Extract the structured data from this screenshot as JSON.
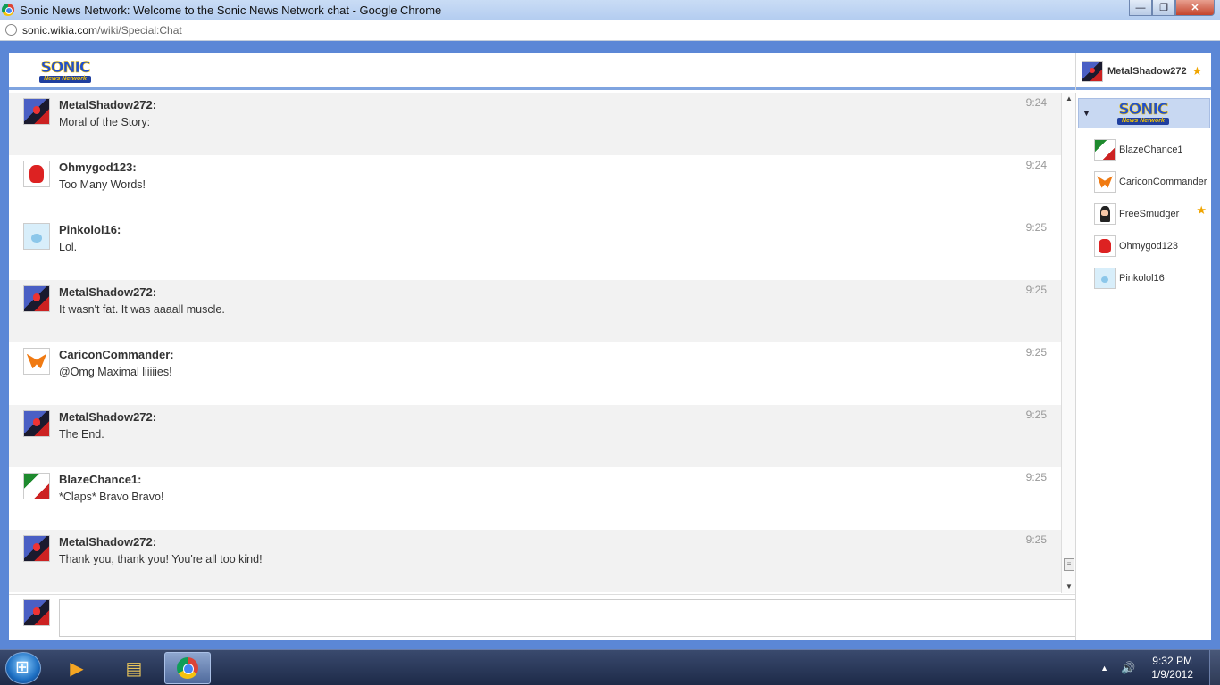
{
  "window": {
    "title": "Sonic News Network: Welcome to the Sonic News Network chat - Google Chrome",
    "minimize": "—",
    "maximize": "❐",
    "close": "✕"
  },
  "address": {
    "domain": "sonic.wikia.com",
    "path": "/wiki/Special:Chat"
  },
  "logo": {
    "line1": "SONIC",
    "line2": "News Network"
  },
  "current_user": {
    "name": "MetalShadow272",
    "star": "★"
  },
  "messages": [
    {
      "user": "MetalShadow272:",
      "text": "Moral of the Story:",
      "time": "9:24"
    },
    {
      "user": "Ohmygod123:",
      "text": "Too Many Words!",
      "time": "9:24"
    },
    {
      "user": "Pinkolol16:",
      "text": "Lol.",
      "time": "9:25"
    },
    {
      "user": "MetalShadow272:",
      "text": "It wasn't fat. It was aaaall muscle.",
      "time": "9:25"
    },
    {
      "user": "CariconCommander:",
      "text": "@Omg Maximal liiiiies!",
      "time": "9:25"
    },
    {
      "user": "MetalShadow272:",
      "text": "The End.",
      "time": "9:25"
    },
    {
      "user": "BlazeChance1:",
      "text": "*Claps* Bravo Bravo!",
      "time": "9:25"
    },
    {
      "user": "MetalShadow272:",
      "text": "Thank you, thank you! You're all too kind!",
      "time": "9:25"
    }
  ],
  "scrollbar": {
    "up": "▲",
    "down": "▼",
    "grip": "≡"
  },
  "composer": {
    "value": ""
  },
  "sidebar": {
    "toggle": "▼",
    "users": [
      {
        "name": "BlazeChance1"
      },
      {
        "name": "CariconCommander"
      },
      {
        "name": "FreeSmudger",
        "star": "★"
      },
      {
        "name": "Ohmygod123"
      },
      {
        "name": "Pinkolol16"
      }
    ]
  },
  "taskbar": {
    "tray_arrow": "▲",
    "volume": "🔊",
    "time": "9:32 PM",
    "date": "1/9/2012",
    "media_icon": "▶",
    "explorer_icon": "▤"
  }
}
